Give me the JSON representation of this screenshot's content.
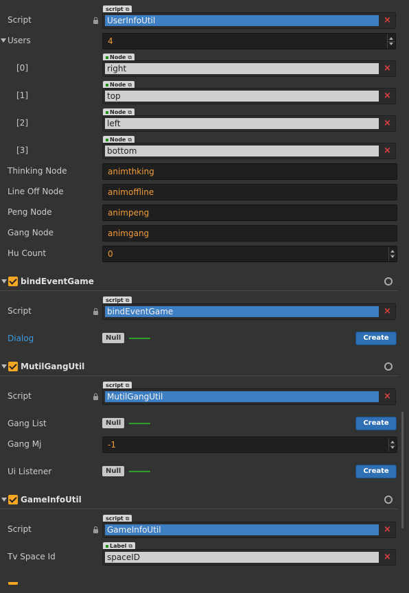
{
  "userInfoUtil": {
    "script_label": "Script",
    "script_tag": "script",
    "script_value": "UserInfoUtil",
    "users_label": "Users",
    "users_count": "4",
    "users": [
      {
        "index": "[0]",
        "tag": "Node",
        "value": "right"
      },
      {
        "index": "[1]",
        "tag": "Node",
        "value": "top"
      },
      {
        "index": "[2]",
        "tag": "Node",
        "value": "left"
      },
      {
        "index": "[3]",
        "tag": "Node",
        "value": "bottom"
      }
    ],
    "thinking_label": "Thinking Node",
    "thinking_value": "animthking",
    "lineoff_label": "Line Off Node",
    "lineoff_value": "animoffline",
    "peng_label": "Peng Node",
    "peng_value": "animpeng",
    "gang_label": "Gang Node",
    "gang_value": "animgang",
    "hucount_label": "Hu Count",
    "hucount_value": "0"
  },
  "bindEventGame": {
    "title": "bindEventGame",
    "script_label": "Script",
    "script_tag": "script",
    "script_value": "bindEventGame",
    "dialog_label": "Dialog",
    "null_text": "Null",
    "create_label": "Create"
  },
  "mutilGangUtil": {
    "title": "MutilGangUtil",
    "script_label": "Script",
    "script_tag": "script",
    "script_value": "MutilGangUtil",
    "ganglist_label": "Gang List",
    "null_text": "Null",
    "create_label": "Create",
    "gangmj_label": "Gang Mj",
    "gangmj_value": "-1",
    "uilistener_label": "Ui Listener",
    "null_text2": "Null",
    "create_label2": "Create"
  },
  "gameInfoUtil": {
    "title": "GameInfoUtil",
    "script_label": "Script",
    "script_tag": "script",
    "script_value": "GameInfoUtil",
    "spaceid_label": "Tv Space Id",
    "spaceid_tag": "Label",
    "spaceid_value": "spaceID"
  },
  "icons": {
    "remove": "×",
    "external": "⧉"
  },
  "colors": {
    "background": "#333333",
    "script_fill": "#3e7ec3",
    "number_text": "#f29c38",
    "accent_check": "#f5a623",
    "remove_x": "#e04040",
    "link_label": "#3b9ce0"
  }
}
